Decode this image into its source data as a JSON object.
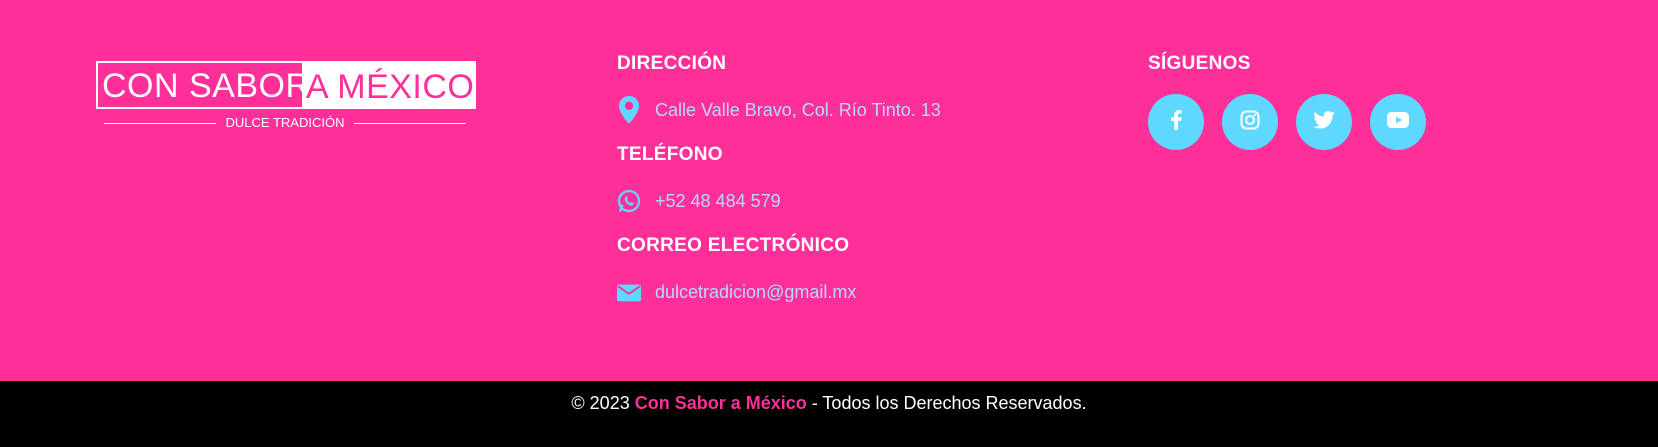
{
  "logo": {
    "word_outline": "CON SABOR",
    "word_filled": "A MÉXICO",
    "tagline": "DULCE TRADICIÓN"
  },
  "contact": {
    "address_heading": "DIRECCIÓN",
    "address": "Calle Valle Bravo, Col. Río Tinto. 13",
    "phone_heading": "TELÉFONO",
    "phone": "+52 48 484 579",
    "email_heading": "CORREO ELECTRÓNICO",
    "email": "dulcetradicion@gmail.mx",
    "icons": [
      "map-marker-icon",
      "whatsapp-icon",
      "envelope-icon"
    ]
  },
  "social": {
    "heading": "SÍGUENOS",
    "networks": [
      "facebook",
      "instagram",
      "twitter",
      "youtube"
    ]
  },
  "footer_bottom": {
    "prefix": "© 2023 ",
    "brand": "Con Sabor a México",
    "suffix": " - Todos los Derechos Reservados."
  },
  "colors": {
    "background": "#ff2f9a",
    "bottom_bar": "#000000",
    "accent": "#5ed8ff",
    "contact_text": "#b8d8ff",
    "brand_text": "#ff2f9a"
  }
}
